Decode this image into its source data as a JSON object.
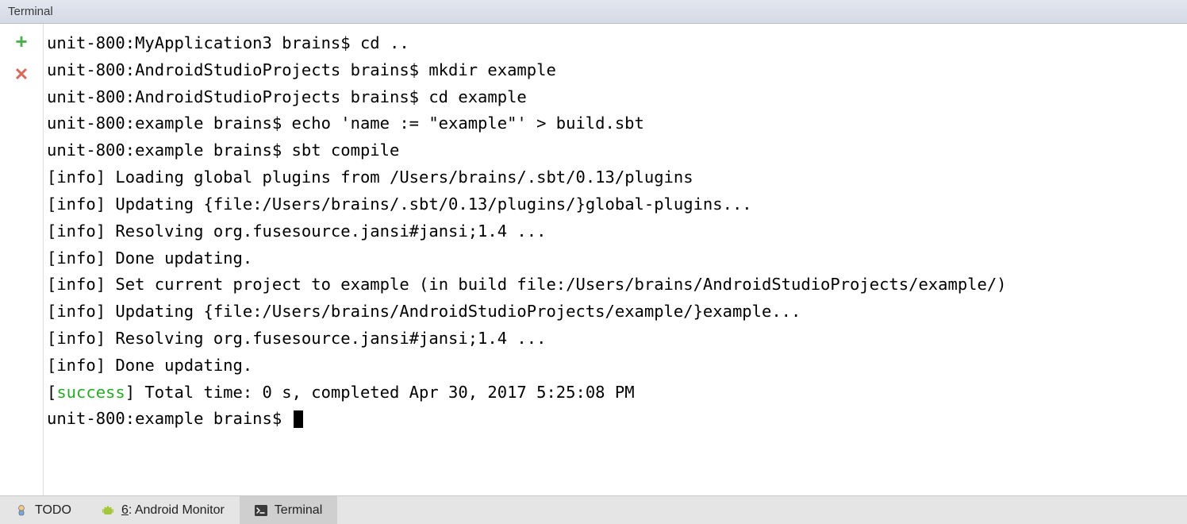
{
  "header": {
    "title": "Terminal"
  },
  "toolbar": {
    "add_label": "+",
    "close_label": "✕"
  },
  "terminal": {
    "lines": [
      {
        "type": "plain",
        "text": "unit-800:MyApplication3 brains$ cd .."
      },
      {
        "type": "plain",
        "text": "unit-800:AndroidStudioProjects brains$ mkdir example"
      },
      {
        "type": "plain",
        "text": "unit-800:AndroidStudioProjects brains$ cd example"
      },
      {
        "type": "plain",
        "text": "unit-800:example brains$ echo 'name := \"example\"' > build.sbt"
      },
      {
        "type": "plain",
        "text": "unit-800:example brains$ sbt compile"
      },
      {
        "type": "info",
        "text": "Loading global plugins from /Users/brains/.sbt/0.13/plugins"
      },
      {
        "type": "info",
        "text": "Updating {file:/Users/brains/.sbt/0.13/plugins/}global-plugins..."
      },
      {
        "type": "info",
        "text": "Resolving org.fusesource.jansi#jansi;1.4 ..."
      },
      {
        "type": "info",
        "text": "Done updating."
      },
      {
        "type": "info",
        "text": "Set current project to example (in build file:/Users/brains/AndroidStudioProjects/example/)"
      },
      {
        "type": "info",
        "text": "Updating {file:/Users/brains/AndroidStudioProjects/example/}example..."
      },
      {
        "type": "info",
        "text": "Resolving org.fusesource.jansi#jansi;1.4 ..."
      },
      {
        "type": "info",
        "text": "Done updating."
      },
      {
        "type": "success",
        "text": "Total time: 0 s, completed Apr 30, 2017 5:25:08 PM"
      },
      {
        "type": "prompt",
        "text": "unit-800:example brains$ "
      }
    ],
    "info_tag": "info",
    "success_tag": "success"
  },
  "footer": {
    "tabs": [
      {
        "id": "todo",
        "label": "TODO",
        "active": false,
        "icon": "todo-icon"
      },
      {
        "id": "android-monitor",
        "label_mnemonic": "6",
        "label_rest": ": Android Monitor",
        "active": false,
        "icon": "android-icon"
      },
      {
        "id": "terminal",
        "label": "Terminal",
        "active": true,
        "icon": "terminal-icon"
      }
    ]
  }
}
